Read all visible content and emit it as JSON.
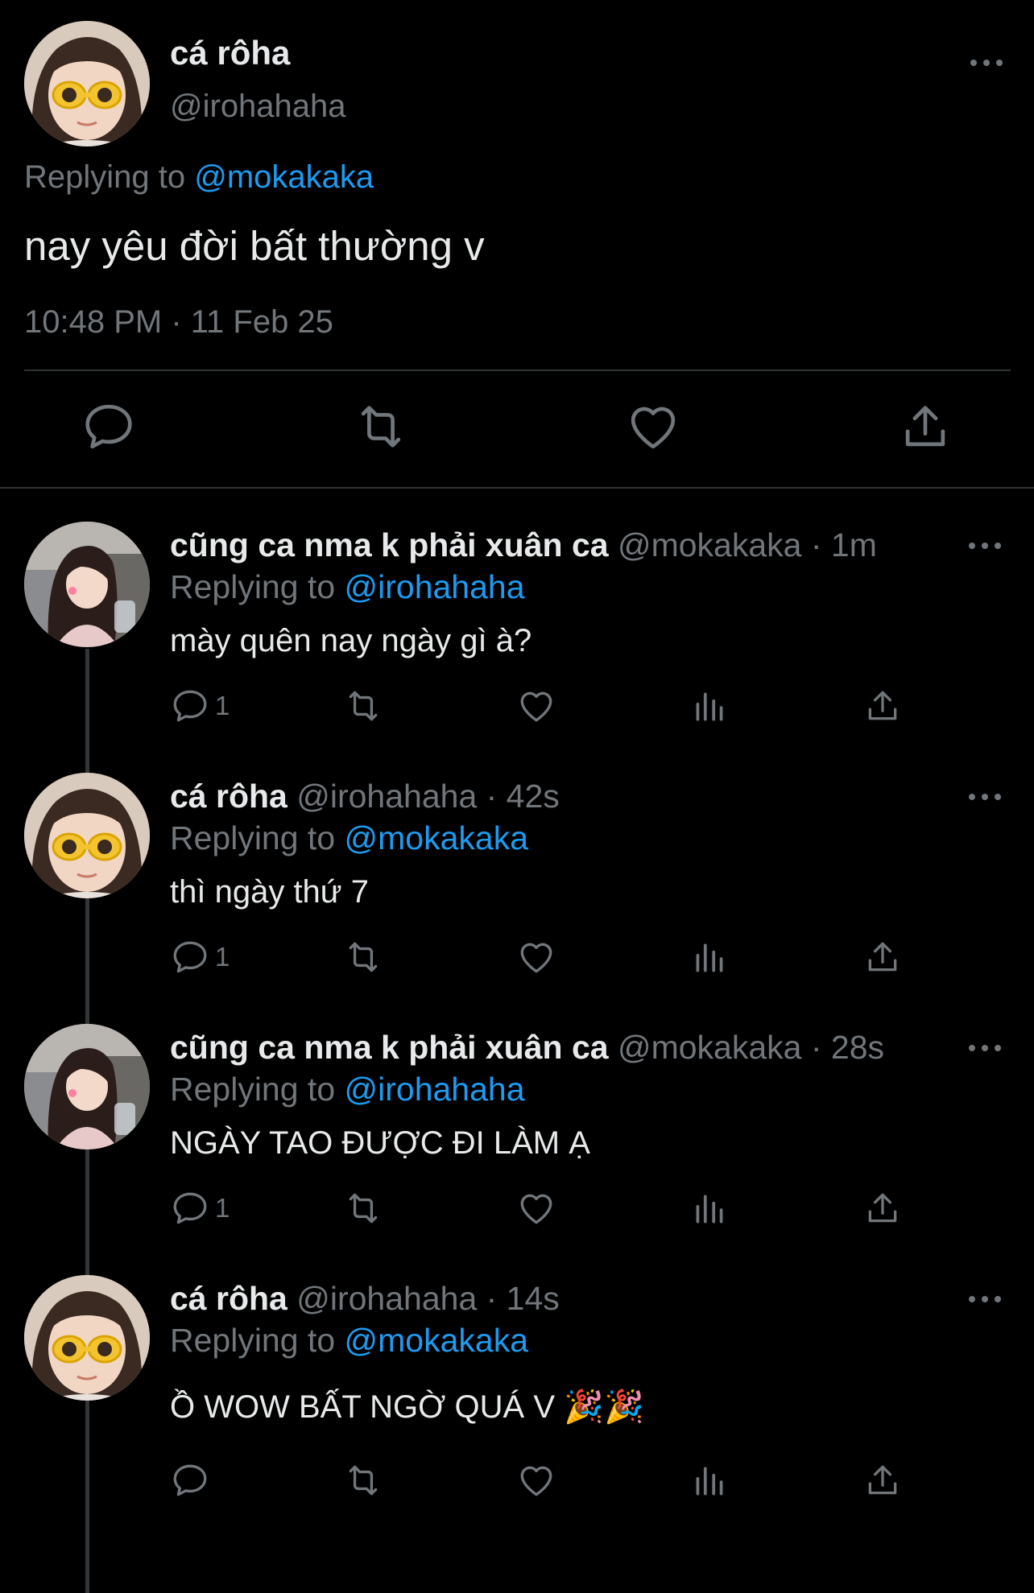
{
  "main_tweet": {
    "name": "cá rôha",
    "handle": "@irohahaha",
    "replying_prefix": "Replying to ",
    "replying_to": "@mokakaka",
    "text": "nay yêu đời bất thường v",
    "timestamp": "10:48 PM · 11 Feb 25"
  },
  "replies": [
    {
      "name": "cũng ca nma k phải xuân ca",
      "handle": "@mokakaka",
      "time": " · 1m",
      "replying_prefix": "Replying to ",
      "replying_to": "@irohahaha",
      "text": "mày quên nay ngày gì à?",
      "reply_count": "1"
    },
    {
      "name": "cá rôha",
      "handle": "@irohahaha",
      "time": " · 42s",
      "replying_prefix": "Replying to ",
      "replying_to": "@mokakaka",
      "text": "thì ngày thứ 7",
      "reply_count": "1"
    },
    {
      "name": "cũng ca nma k phải xuân ca",
      "handle": "@mokakaka",
      "time": " · 28s",
      "replying_prefix": "Replying to ",
      "replying_to": "@irohahaha",
      "text": "NGÀY TAO ĐƯỢC ĐI LÀM Ạ",
      "reply_count": "1"
    },
    {
      "name": "cá rôha",
      "handle": "@irohahaha",
      "time": " · 14s",
      "replying_prefix": "Replying to ",
      "replying_to": "@mokakaka",
      "text": "Ồ WOW BẤT NGỜ QUÁ V 🎉🎉",
      "reply_count": ""
    }
  ],
  "icons": {
    "reply": "speech-bubble-icon",
    "retweet": "retweet-icon",
    "like": "heart-icon",
    "views": "bar-chart-icon",
    "share": "share-upload-icon",
    "more": "more-dots-icon"
  },
  "colors": {
    "background": "#000000",
    "text": "#e7e9ea",
    "secondary": "#71767b",
    "link": "#1d9bf0",
    "divider": "#2f3336"
  }
}
